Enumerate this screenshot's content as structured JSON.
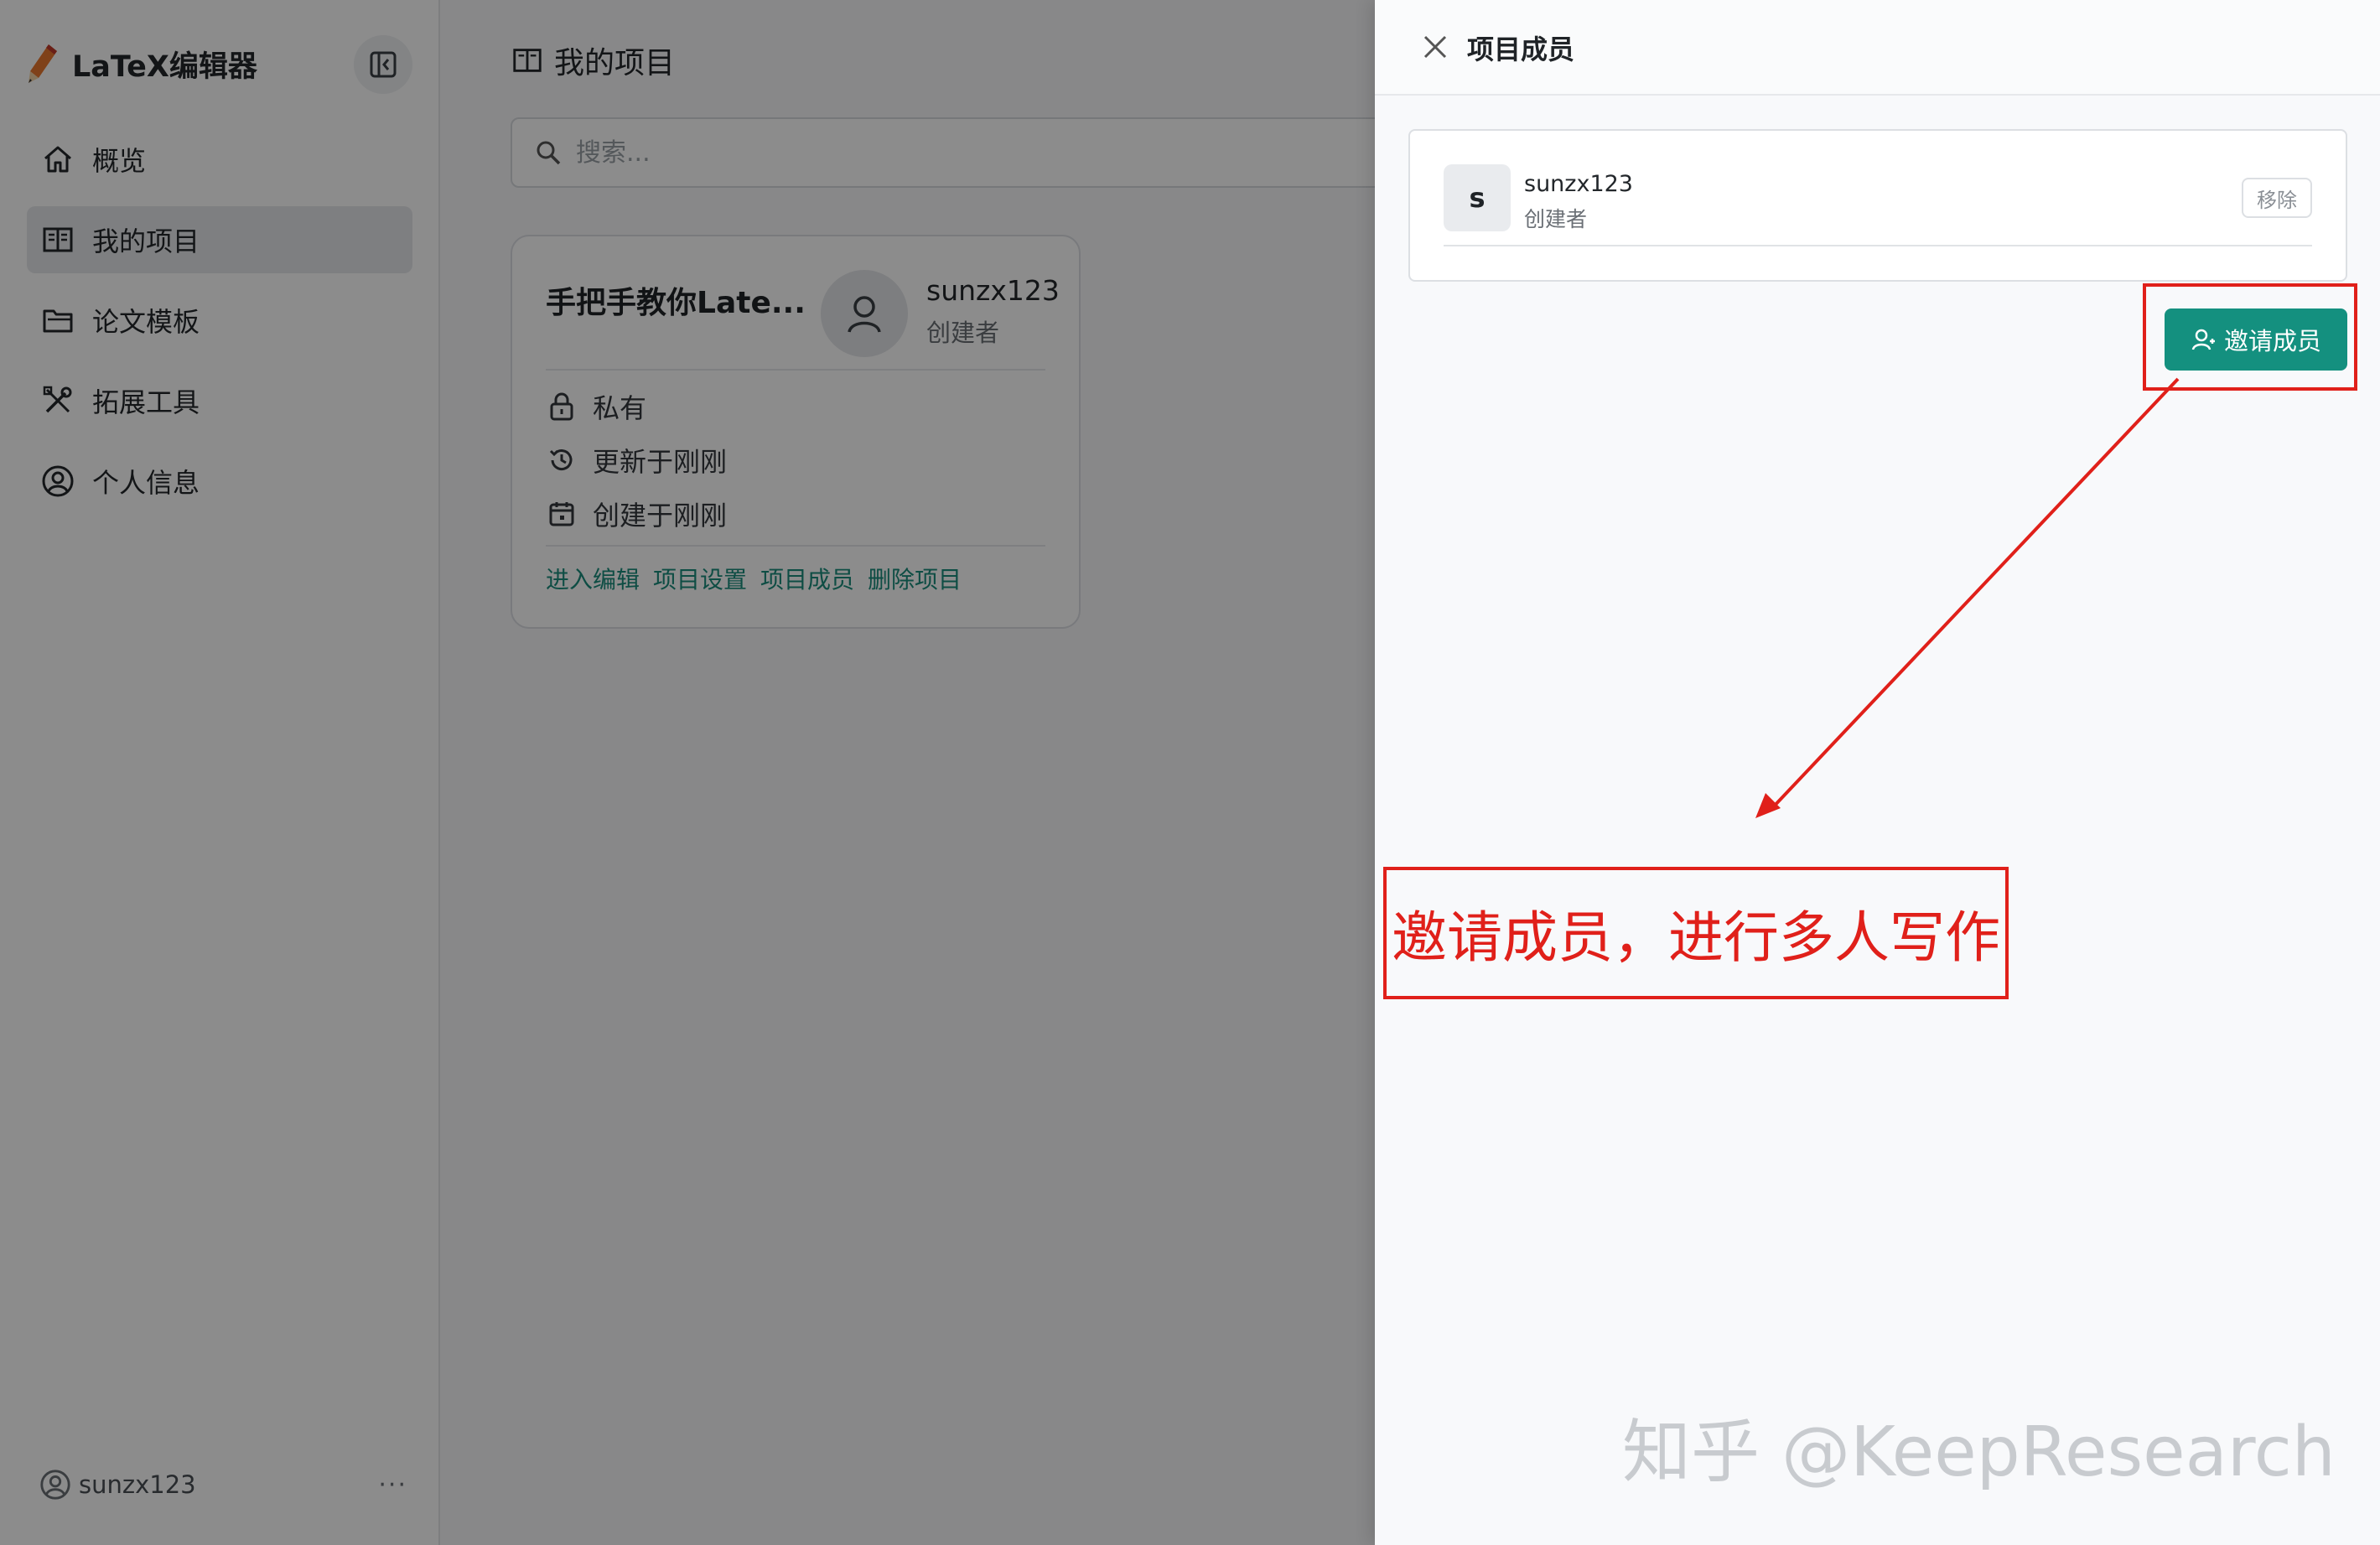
{
  "app": {
    "brand": "LaTeX编辑器"
  },
  "sidebar": {
    "items": [
      {
        "label": "概览",
        "icon": "home-icon"
      },
      {
        "label": "我的项目",
        "icon": "book-icon"
      },
      {
        "label": "论文模板",
        "icon": "folder-icon"
      },
      {
        "label": "拓展工具",
        "icon": "tools-icon"
      },
      {
        "label": "个人信息",
        "icon": "user-circle-icon"
      }
    ],
    "active_index": 1,
    "footer_user": "sunzx123",
    "footer_more": "···"
  },
  "main": {
    "heading": "我的项目",
    "search_placeholder": "搜索..."
  },
  "project_card": {
    "title": "手把手教你Late...",
    "owner": "sunzx123",
    "owner_role": "创建者",
    "visibility": "私有",
    "updated": "更新于刚刚",
    "created": "创建于刚刚",
    "actions": [
      "进入编辑",
      "项目设置",
      "项目成员",
      "删除项目"
    ]
  },
  "drawer": {
    "title": "项目成员",
    "member": {
      "avatar_letter": "s",
      "name": "sunzx123",
      "role": "创建者",
      "remove_label": "移除"
    },
    "invite_label": "邀请成员"
  },
  "annotation": {
    "text": "邀请成员，进行多人写作",
    "color": "#e0201a"
  },
  "watermark": "知乎 @KeepResearch",
  "colors": {
    "accent": "#14907f",
    "link": "#1a8c7c"
  }
}
